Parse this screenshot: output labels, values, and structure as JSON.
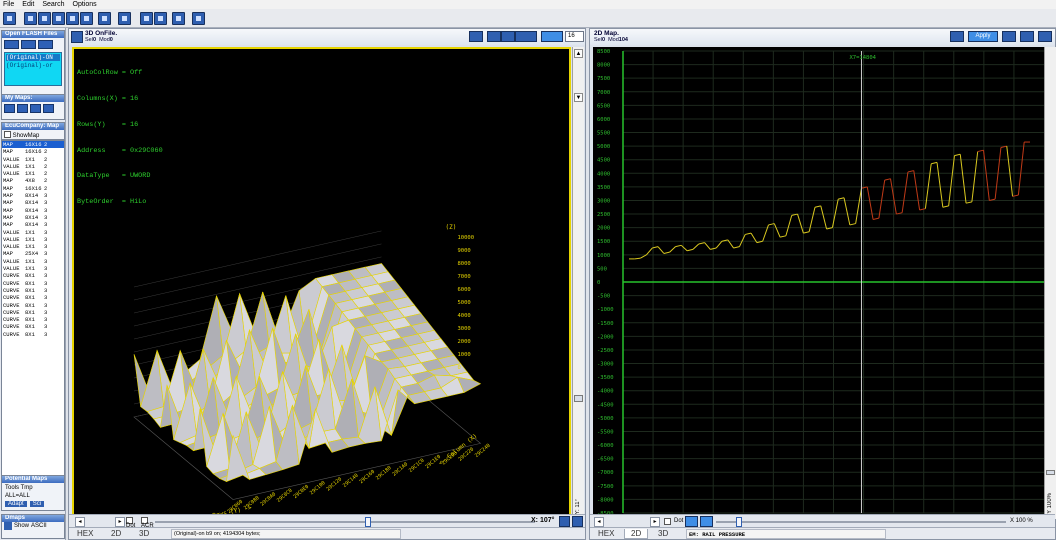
{
  "menu": [
    "File",
    "Edit",
    "Search",
    "Options"
  ],
  "left": {
    "open_flash_title": "Open FLASH Files",
    "files": [
      "(Original)-ON",
      "(Original)-or"
    ],
    "my_maps_title": "My Maps:",
    "ecu_title": "EcuCompany: Map",
    "show_map_label": "ShowMap",
    "maps": [
      [
        "MAP",
        "16X16",
        "2"
      ],
      [
        "MAP",
        "16X16",
        "2"
      ],
      [
        "VALUE",
        "1X1",
        "2"
      ],
      [
        "VALUE",
        "1X1",
        "2"
      ],
      [
        "VALUE",
        "1X1",
        "2"
      ],
      [
        "MAP",
        "4X8",
        "2"
      ],
      [
        "MAP",
        "16X16",
        "2"
      ],
      [
        "MAP",
        "8X14",
        "3"
      ],
      [
        "MAP",
        "8X14",
        "3"
      ],
      [
        "MAP",
        "8X14",
        "3"
      ],
      [
        "MAP",
        "8X14",
        "3"
      ],
      [
        "MAP",
        "8X14",
        "3"
      ],
      [
        "VALUE",
        "1X1",
        "3"
      ],
      [
        "VALUE",
        "1X1",
        "3"
      ],
      [
        "VALUE",
        "1X1",
        "3"
      ],
      [
        "MAP",
        "25X4",
        "3"
      ],
      [
        "VALUE",
        "1X1",
        "3"
      ],
      [
        "VALUE",
        "1X1",
        "3"
      ],
      [
        "CURVE",
        "8X1",
        "3"
      ],
      [
        "CURVE",
        "8X1",
        "3"
      ],
      [
        "CURVE",
        "8X1",
        "3"
      ],
      [
        "CURVE",
        "8X1",
        "3"
      ],
      [
        "CURVE",
        "8X1",
        "3"
      ],
      [
        "CURVE",
        "8X1",
        "3"
      ],
      [
        "CURVE",
        "8X1",
        "3"
      ],
      [
        "CURVE",
        "8X1",
        "3"
      ],
      [
        "CURVE",
        "8X1",
        "3"
      ]
    ],
    "potential_title": "Potential Maps",
    "potential_items": [
      "Tools Tmp",
      "ALL=ALL"
    ],
    "potential_buttons": [
      "Adapt",
      "Sci"
    ],
    "dmaps_title": "Dmaps",
    "show_label": "Show",
    "ascii_label": "ASCII"
  },
  "pane3d": {
    "title": "3D OnFile.",
    "sel_label": "Sel",
    "sel_value": "0",
    "mod_label": "Mod",
    "mod_value": "0",
    "combo_value": "16",
    "info": [
      "AutoColRow = Off",
      "Columns(X) = 16",
      "Rows(Y)    = 16",
      "Address    = 0x29C060",
      "DataType   = UWORD",
      "ByteOrder  = HiLo"
    ],
    "z_label": "(Z)",
    "z_ticks": [
      "10000",
      "9000",
      "8000",
      "7000",
      "6000",
      "5000",
      "4000",
      "3000",
      "2000",
      "1000",
      "0"
    ],
    "rows_label": "Rows (Y) ->",
    "columns_label": "<- Column (X)",
    "row_ticks": [
      "29C060",
      "29C080",
      "29C0A0",
      "29C0C0",
      "29C0E0",
      "29C100",
      "29C120",
      "29C140",
      "29C160",
      "29C180",
      "29C1A0",
      "29C1C0",
      "29C1E0",
      "29C200",
      "29C220",
      "29C240"
    ],
    "y_rotation": "Y: 11°",
    "x_rotation": "X: 107°",
    "dot_label": "Dot",
    "acr_label": "ACR",
    "tabs": [
      "HEX",
      "2D",
      "3D"
    ],
    "status": "(Original)-on b9 on;  4194304 bytes;"
  },
  "pane2d": {
    "title": "2D Map.",
    "sel_label": "Sel",
    "sel_value": "0",
    "mod_label": "Mod",
    "mod_value": "104",
    "apply_label": "Apply",
    "cursor_label": "X7=14804",
    "y_ticks": [
      "8500",
      "8000",
      "7500",
      "7000",
      "6500",
      "6000",
      "5500",
      "5000",
      "4500",
      "4000",
      "3500",
      "3000",
      "2500",
      "2000",
      "1500",
      "1000",
      "500",
      "0",
      "-500",
      "-1000",
      "-1500",
      "-2000",
      "-2500",
      "-3000",
      "-3500",
      "-4000",
      "-4500",
      "-5000",
      "-5500",
      "-6000",
      "-6500",
      "-7000",
      "-7500",
      "-8000",
      "-8500"
    ],
    "zoom_y": "Y 100%",
    "zoom_x": "X 100 %",
    "dot_label": "Dot",
    "tabs": [
      "HEX",
      "2D",
      "3D"
    ],
    "status": "EM: RAIL PRESSURE"
  },
  "colors": {
    "trace_yellow": "#d9c81f",
    "trace_red": "#c03a17",
    "grid": "#1e2a1e",
    "axis_green": "#27c22c",
    "info_green": "#2ed12e",
    "cursor": "#cfcfcf",
    "frame_yellow": "#e6d400"
  },
  "chart_data": {
    "type": "line",
    "xlabel": "",
    "ylabel": "",
    "ylim": [
      -8500,
      8500
    ],
    "x_start": 0,
    "series": [
      {
        "values": [
          850,
          850,
          880,
          1000,
          1250,
          1300,
          1050,
          1100,
          1300,
          1350,
          1150,
          1200,
          1400,
          1450,
          1200,
          1250,
          1500,
          1550,
          1250,
          1300,
          1750,
          1800,
          1450,
          1500,
          2100,
          2150,
          1650,
          1700,
          2450,
          2500,
          1800,
          1850,
          2750,
          2800,
          1950,
          2000,
          3050,
          3100,
          2100,
          2150,
          3450,
          3500,
          2300,
          2350,
          3750,
          3800,
          2500,
          2550,
          4050,
          4100,
          2650,
          2700,
          4350,
          4400,
          2750,
          2800,
          4650,
          4700,
          2900,
          2950,
          4800,
          4850,
          3000,
          3050,
          4950,
          5000,
          3150,
          3200,
          5150,
          5150
        ]
      }
    ],
    "red_segments": [
      [
        40,
        51
      ],
      [
        60,
        65
      ],
      [
        66,
        70
      ]
    ]
  }
}
